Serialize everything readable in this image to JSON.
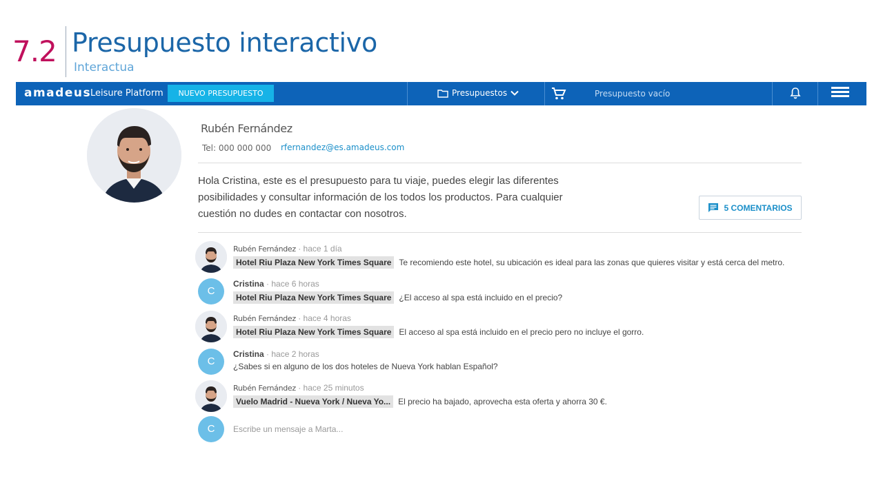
{
  "slide": {
    "number": "7.2",
    "title": "Presupuesto interactivo",
    "subtitle": "Interactua"
  },
  "navbar": {
    "brand": "amadeus",
    "platform": "Leisure Platform",
    "new_button": "NUEVO PRESUPUESTO",
    "folders_label": "Presupuestos",
    "cart_status": "Presupuesto vacío",
    "colors": {
      "bar": "#0d63b8",
      "button": "#16b3e7"
    }
  },
  "agent": {
    "name": "Rubén Fernández",
    "tel": "Tel: 000 000 000",
    "email": "rfernandez@es.amadeus.com"
  },
  "intro": "Hola Cristina, este es el presupuesto para tu viaje, puedes elegir las diferentes posibilidades y consultar información de los todos los productos. Para cualquier cuestión no dudes en contactar con nosotros.",
  "comments_button": "5 COMENTARIOS",
  "comments": [
    {
      "author": "Rubén Fernández",
      "role": "agent",
      "time": "· hace 1 día",
      "tag": "Hotel Riu Plaza New York Times Square",
      "text": "Te recomiendo este hotel, su ubicación es ideal para las zonas que quieres visitar y está cerca del metro."
    },
    {
      "author": "Cristina",
      "role": "client",
      "initial": "C",
      "time": "· hace 6 horas",
      "tag": "Hotel Riu Plaza New York Times Square",
      "text": "¿El acceso al spa está incluido en el precio?"
    },
    {
      "author": "Rubén Fernández",
      "role": "agent",
      "time": "· hace 4 horas",
      "tag": "Hotel Riu Plaza New York Times Square",
      "text": "El acceso al spa está incluido en el precio pero no incluye el gorro."
    },
    {
      "author": "Cristina",
      "role": "client",
      "initial": "C",
      "time": "· hace 2 horas",
      "tag": "",
      "text": "¿Sabes si en alguno de los dos hoteles de Nueva York hablan Español?"
    },
    {
      "author": "Rubén Fernández",
      "role": "agent",
      "time": "· hace 25 minutos",
      "tag": "Vuelo Madrid - Nueva York / Nueva Yo...",
      "text": "El precio ha bajado, aprovecha esta oferta y ahorra 30 €."
    }
  ],
  "composer": {
    "initial": "C",
    "placeholder": "Escribe un mensaje a Marta..."
  }
}
